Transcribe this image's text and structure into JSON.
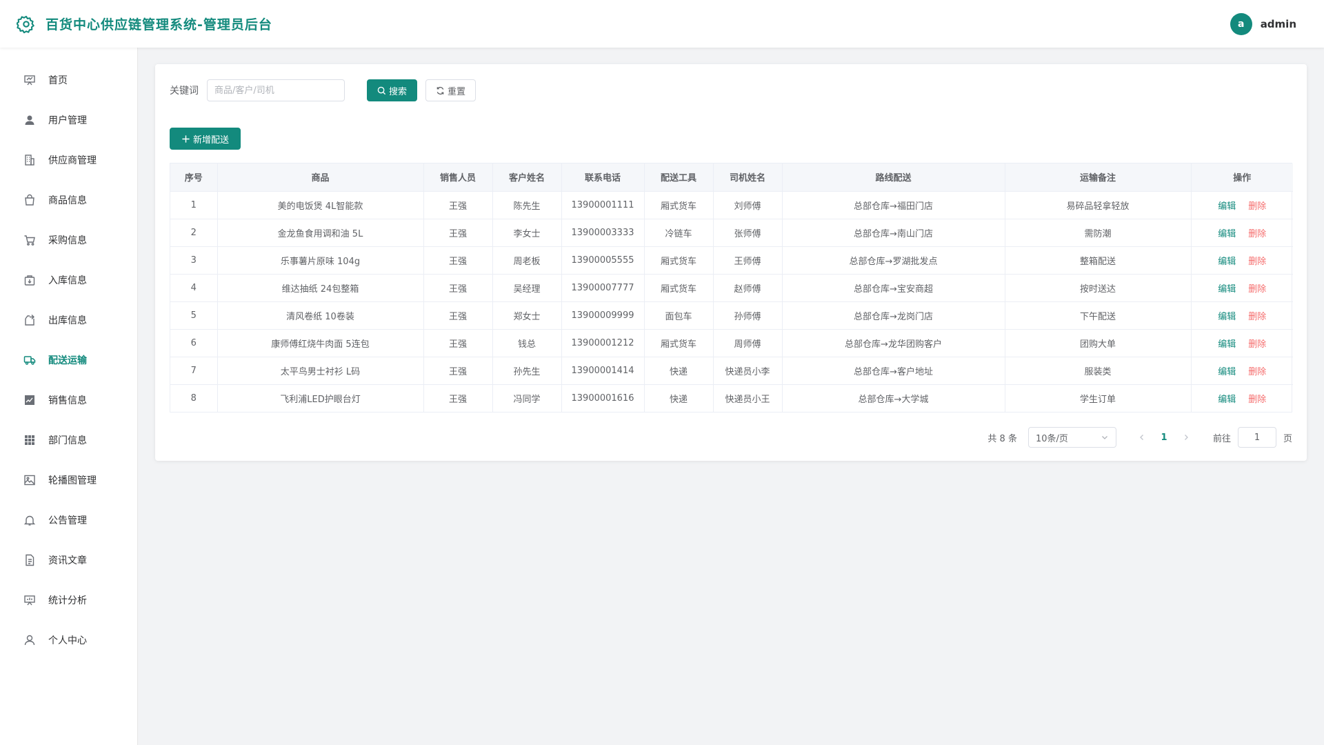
{
  "header": {
    "title": "百货中心供应链管理系统-管理员后台",
    "user_initial": "a",
    "username": "admin"
  },
  "colors": {
    "accent": "#138a7d",
    "danger": "#f56c6c"
  },
  "sidebar": {
    "items": [
      {
        "label": "首页",
        "icon": "chart-board-icon"
      },
      {
        "label": "用户管理",
        "icon": "user-icon"
      },
      {
        "label": "供应商管理",
        "icon": "building-icon"
      },
      {
        "label": "商品信息",
        "icon": "shopping-bag-icon"
      },
      {
        "label": "采购信息",
        "icon": "cart-icon"
      },
      {
        "label": "入库信息",
        "icon": "box-in-icon"
      },
      {
        "label": "出库信息",
        "icon": "box-out-icon"
      },
      {
        "label": "配送运输",
        "icon": "truck-icon",
        "active": true
      },
      {
        "label": "销售信息",
        "icon": "trend-chart-icon"
      },
      {
        "label": "部门信息",
        "icon": "grid-icon"
      },
      {
        "label": "轮播图管理",
        "icon": "picture-icon"
      },
      {
        "label": "公告管理",
        "icon": "bell-icon"
      },
      {
        "label": "资讯文章",
        "icon": "document-icon"
      },
      {
        "label": "统计分析",
        "icon": "stats-board-icon"
      },
      {
        "label": "个人中心",
        "icon": "user-outline-icon"
      }
    ]
  },
  "search": {
    "label": "关键词",
    "placeholder": "商品/客户/司机",
    "value": "",
    "search_label": "搜索",
    "reset_label": "重置"
  },
  "toolbar": {
    "add_label": "新增配送"
  },
  "table": {
    "columns": [
      "序号",
      "商品",
      "销售人员",
      "客户姓名",
      "联系电话",
      "配送工具",
      "司机姓名",
      "路线配送",
      "运输备注",
      "操作"
    ],
    "edit_label": "编辑",
    "delete_label": "删除",
    "rows": [
      {
        "no": "1",
        "product": "美的电饭煲 4L智能款",
        "sales": "王强",
        "customer": "陈先生",
        "phone": "13900001111",
        "tool": "厢式货车",
        "driver": "刘师傅",
        "route": "总部仓库→福田门店",
        "remark": "易碎品轻拿轻放"
      },
      {
        "no": "2",
        "product": "金龙鱼食用调和油 5L",
        "sales": "王强",
        "customer": "李女士",
        "phone": "13900003333",
        "tool": "冷链车",
        "driver": "张师傅",
        "route": "总部仓库→南山门店",
        "remark": "需防潮"
      },
      {
        "no": "3",
        "product": "乐事薯片原味 104g",
        "sales": "王强",
        "customer": "周老板",
        "phone": "13900005555",
        "tool": "厢式货车",
        "driver": "王师傅",
        "route": "总部仓库→罗湖批发点",
        "remark": "整箱配送"
      },
      {
        "no": "4",
        "product": "维达抽纸 24包整箱",
        "sales": "王强",
        "customer": "吴经理",
        "phone": "13900007777",
        "tool": "厢式货车",
        "driver": "赵师傅",
        "route": "总部仓库→宝安商超",
        "remark": "按时送达"
      },
      {
        "no": "5",
        "product": "清风卷纸 10卷装",
        "sales": "王强",
        "customer": "郑女士",
        "phone": "13900009999",
        "tool": "面包车",
        "driver": "孙师傅",
        "route": "总部仓库→龙岗门店",
        "remark": "下午配送"
      },
      {
        "no": "6",
        "product": "康师傅红烧牛肉面 5连包",
        "sales": "王强",
        "customer": "钱总",
        "phone": "13900001212",
        "tool": "厢式货车",
        "driver": "周师傅",
        "route": "总部仓库→龙华团购客户",
        "remark": "团购大单"
      },
      {
        "no": "7",
        "product": "太平鸟男士衬衫 L码",
        "sales": "王强",
        "customer": "孙先生",
        "phone": "13900001414",
        "tool": "快递",
        "driver": "快递员小李",
        "route": "总部仓库→客户地址",
        "remark": "服装类"
      },
      {
        "no": "8",
        "product": "飞利浦LED护眼台灯",
        "sales": "王强",
        "customer": "冯同学",
        "phone": "13900001616",
        "tool": "快递",
        "driver": "快递员小王",
        "route": "总部仓库→大学城",
        "remark": "学生订单"
      }
    ]
  },
  "pagination": {
    "total_text": "共 8 条",
    "page_size": "10条/页",
    "current_page": "1",
    "goto_label": "前往",
    "goto_value": "1",
    "page_suffix": "页"
  }
}
